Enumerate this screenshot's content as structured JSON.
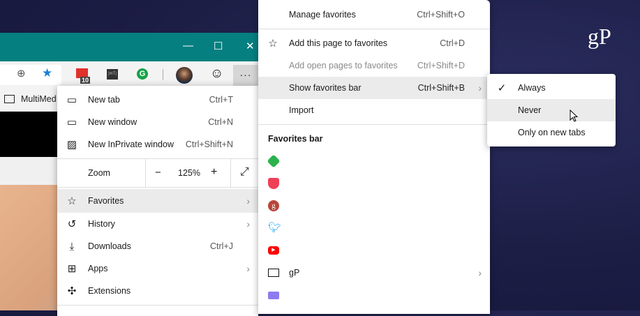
{
  "logo": "gP",
  "toolbar": {
    "extension_badge": "10",
    "mt_label": "|mT|",
    "more": "···"
  },
  "bookmarks": {
    "folder": "MultiMed"
  },
  "main_menu": {
    "items": [
      {
        "label": "New tab",
        "shortcut": "Ctrl+T"
      },
      {
        "label": "New window",
        "shortcut": "Ctrl+N"
      },
      {
        "label": "New InPrivate window",
        "shortcut": "Ctrl+Shift+N"
      }
    ],
    "zoom": {
      "label": "Zoom",
      "value": "125%",
      "minus": "−",
      "plus": "+"
    },
    "items2": [
      {
        "label": "Favorites"
      },
      {
        "label": "History"
      },
      {
        "label": "Downloads",
        "shortcut": "Ctrl+J"
      },
      {
        "label": "Apps"
      },
      {
        "label": "Extensions"
      }
    ]
  },
  "favorites_menu": {
    "manage": {
      "label": "Manage favorites",
      "shortcut": "Ctrl+Shift+O"
    },
    "add_page": {
      "label": "Add this page to favorites",
      "shortcut": "Ctrl+D"
    },
    "add_open": {
      "label": "Add open pages to favorites",
      "shortcut": "Ctrl+Shift+D"
    },
    "show_bar": {
      "label": "Show favorites bar",
      "shortcut": "Ctrl+Shift+B"
    },
    "import": {
      "label": "Import"
    },
    "section": "Favorites bar",
    "folder": "gP"
  },
  "submenu": {
    "always": "Always",
    "never": "Never",
    "new_tabs": "Only on new tabs"
  }
}
